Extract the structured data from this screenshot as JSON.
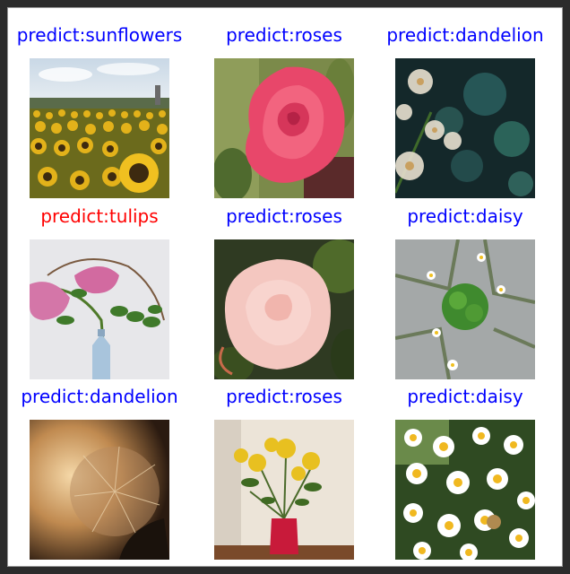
{
  "images": [
    {
      "label": "predict:sunflowers",
      "color": "#0000ff",
      "subject": "sunflowers"
    },
    {
      "label": "predict:roses",
      "color": "#0000ff",
      "subject": "red-rose"
    },
    {
      "label": "predict:dandelion",
      "color": "#0000ff",
      "subject": "dandelion-bokeh"
    },
    {
      "label": "predict:tulips",
      "color": "#ff0000",
      "subject": "pink-flowers-vase"
    },
    {
      "label": "predict:roses",
      "color": "#0000ff",
      "subject": "pink-rose"
    },
    {
      "label": "predict:daisy",
      "color": "#0000ff",
      "subject": "daisies-on-stone"
    },
    {
      "label": "predict:dandelion",
      "color": "#0000ff",
      "subject": "dandelion-seedhead"
    },
    {
      "label": "predict:roses",
      "color": "#0000ff",
      "subject": "yellow-roses-vase"
    },
    {
      "label": "predict:daisy",
      "color": "#0000ff",
      "subject": "daisy-field"
    }
  ]
}
